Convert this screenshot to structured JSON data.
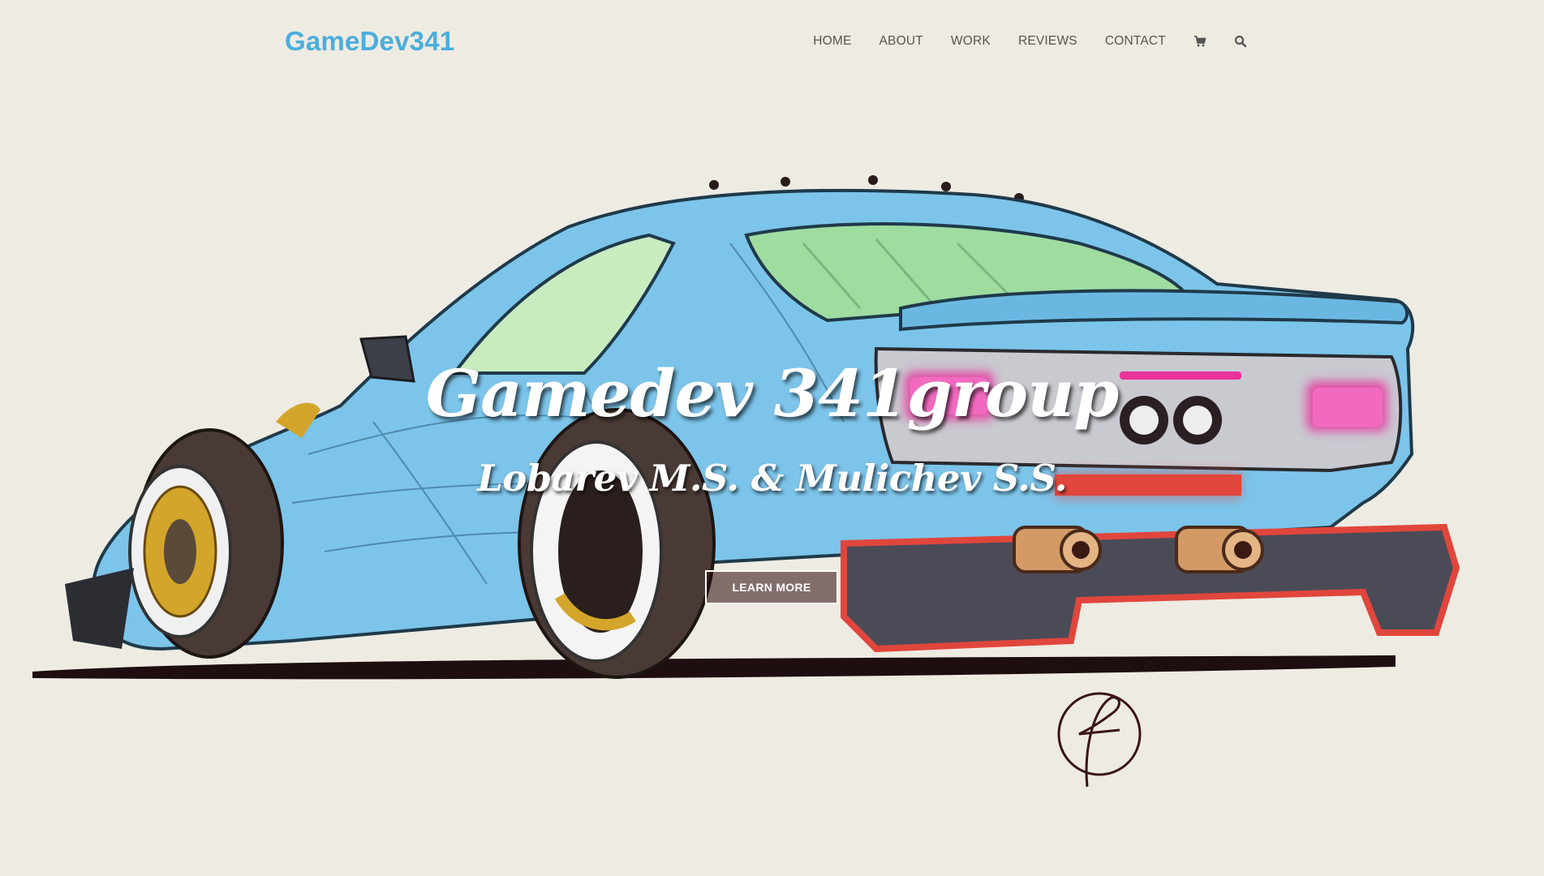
{
  "brand": {
    "name": "GameDev341",
    "color": "#4aaedc"
  },
  "nav": {
    "items": [
      {
        "label": "HOME"
      },
      {
        "label": "ABOUT"
      },
      {
        "label": "WORK"
      },
      {
        "label": "REVIEWS"
      },
      {
        "label": "CONTACT"
      }
    ],
    "icons": [
      "cart-icon",
      "search-icon"
    ]
  },
  "hero": {
    "title": "Gamedev 341group",
    "subtitle": "Lobarev M.S. & Mulichev S.S.",
    "cta_label": "LEARN MORE",
    "illustration": "sketch-car-illustration",
    "background": "#eeebe3",
    "car_body_color": "#7cc4ea",
    "window_color": "#9fdca0",
    "taillight_color": "#e8329c",
    "diffuser_color": "#e0463c"
  }
}
